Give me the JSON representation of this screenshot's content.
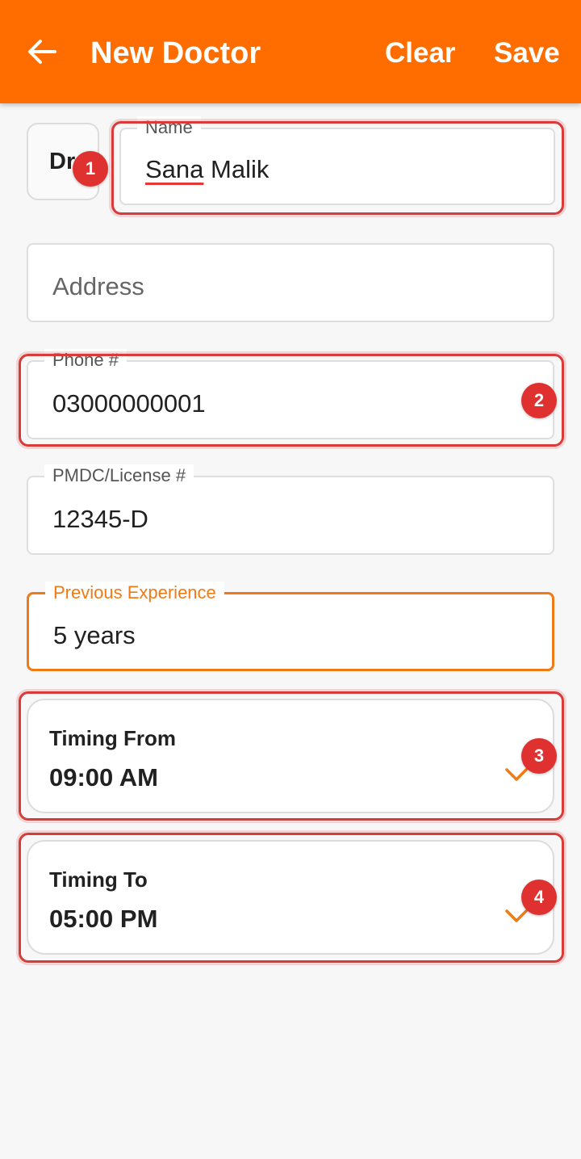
{
  "appbar": {
    "title": "New Doctor",
    "clear_label": "Clear",
    "save_label": "Save",
    "back_icon": "arrow-left-icon"
  },
  "form": {
    "prefix": "Dr.",
    "name": {
      "label": "Name",
      "value_misspelled": "Sana",
      "value_rest": " Malik"
    },
    "address": {
      "placeholder": "Address"
    },
    "phone": {
      "label": "Phone #",
      "value": "03000000001"
    },
    "license": {
      "label": "PMDC/License #",
      "value": "12345-D"
    },
    "experience": {
      "label": "Previous Experience",
      "value": "5 years"
    },
    "timing_from": {
      "label": "Timing From",
      "value": "09:00 AM"
    },
    "timing_to": {
      "label": "Timing To",
      "value": "05:00 PM"
    }
  },
  "markers": [
    "1",
    "2",
    "3",
    "4"
  ],
  "colors": {
    "accent": "#ff6d00",
    "focus": "#ef7a16",
    "highlight": "#d93a3a",
    "marker": "#e03131"
  }
}
